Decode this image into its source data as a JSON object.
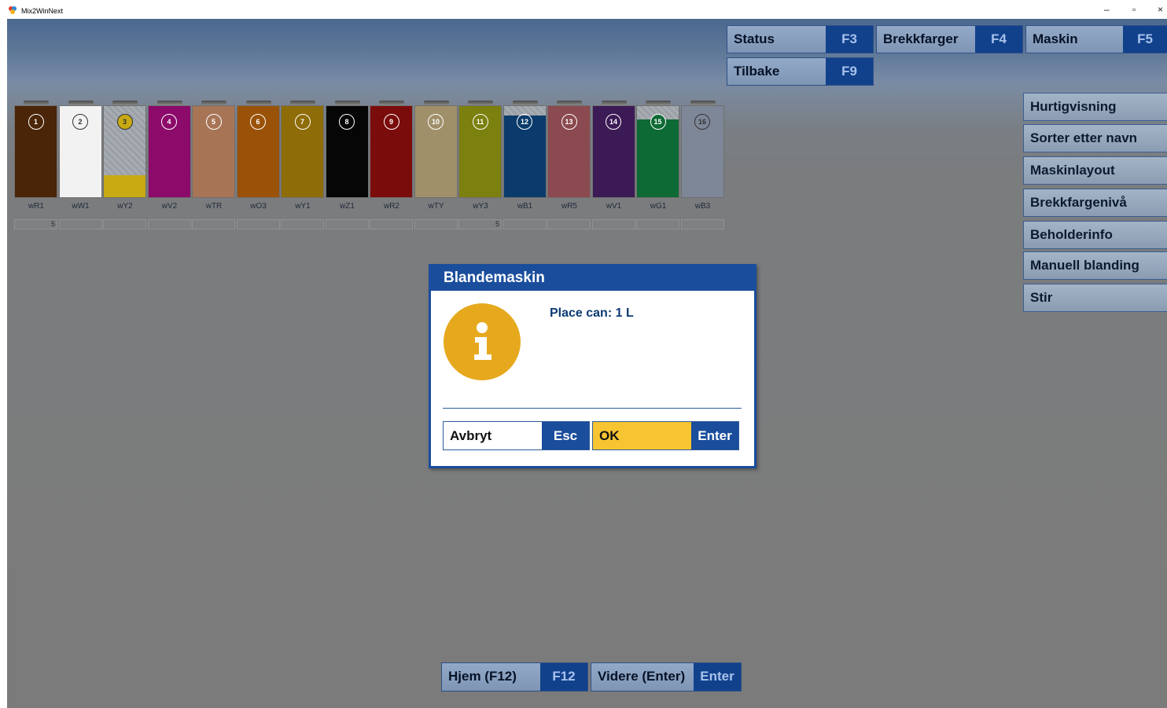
{
  "window": {
    "title": "Mix2WinNext",
    "minimize": "–",
    "restore": "▫",
    "close": "×"
  },
  "top_buttons": [
    {
      "label": "Status",
      "key": "F3"
    },
    {
      "label": "Brekkfarger",
      "key": "F4"
    },
    {
      "label": "Maskin",
      "key": "F5"
    },
    {
      "label": "Tilbake",
      "key": "F9"
    }
  ],
  "side_buttons": [
    "Hurtigvisning",
    "Sorter etter navn",
    "Maskinlayout",
    "Brekkfargenivå",
    "Beholderinfo",
    "Manuell blanding",
    "Stir"
  ],
  "canisters": [
    {
      "num": "1",
      "label": "wR1",
      "value": "5",
      "color": "#4a2508",
      "level": 1.0
    },
    {
      "num": "2",
      "label": "wW1",
      "value": "",
      "color": "#f2f2f2",
      "level": 1.0
    },
    {
      "num": "3",
      "label": "wY2",
      "value": "",
      "color": "#c8aa12",
      "level": 0.24
    },
    {
      "num": "4",
      "label": "wV2",
      "value": "",
      "color": "#8b0a6a",
      "level": 1.0
    },
    {
      "num": "5",
      "label": "wTR",
      "value": "",
      "color": "#a77556",
      "level": 1.0
    },
    {
      "num": "6",
      "label": "wO3",
      "value": "",
      "color": "#9a5208",
      "level": 1.0
    },
    {
      "num": "7",
      "label": "wY1",
      "value": "",
      "color": "#8e6c08",
      "level": 1.0
    },
    {
      "num": "8",
      "label": "wZ1",
      "value": "",
      "color": "#060606",
      "level": 1.0
    },
    {
      "num": "9",
      "label": "wR2",
      "value": "",
      "color": "#7b0c0c",
      "level": 1.0
    },
    {
      "num": "10",
      "label": "wTY",
      "value": "",
      "color": "#a0906a",
      "level": 1.0
    },
    {
      "num": "11",
      "label": "wY3",
      "value": "5",
      "color": "#7b800e",
      "level": 1.0
    },
    {
      "num": "12",
      "label": "wB1",
      "value": "",
      "color": "#0b3b6c",
      "level": 0.9
    },
    {
      "num": "13",
      "label": "wR5",
      "value": "",
      "color": "#8b4a4f",
      "level": 1.0
    },
    {
      "num": "14",
      "label": "wV1",
      "value": "",
      "color": "#3c1a56",
      "level": 1.0
    },
    {
      "num": "15",
      "label": "wG1",
      "value": "",
      "color": "#0e6a34",
      "level": 0.85
    },
    {
      "num": "16",
      "label": "wB3",
      "value": "",
      "color": "#7e8798",
      "level": 1.0
    }
  ],
  "dialog": {
    "title": "Blandemaskin",
    "message": "Place can: 1 L",
    "cancel": {
      "label": "Avbryt",
      "key": "Esc"
    },
    "ok": {
      "label": "OK",
      "key": "Enter"
    }
  },
  "bottom_buttons": [
    {
      "label": "Hjem (F12)",
      "key": "F12"
    },
    {
      "label": "Videre (Enter)",
      "key": "Enter"
    }
  ]
}
